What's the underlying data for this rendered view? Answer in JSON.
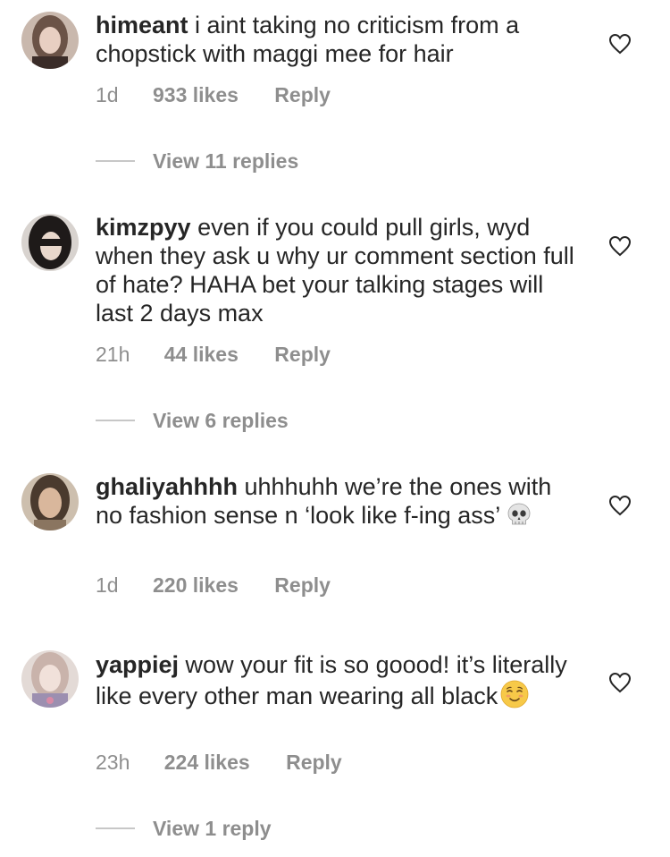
{
  "comments": [
    {
      "username": "himeant",
      "text": " i aint taking no criticism from a chopstick with maggi mee for hair",
      "time": "1d",
      "likes": "933 likes",
      "reply": "Reply",
      "view_replies": "View 11 replies"
    },
    {
      "username": "kimzpyy",
      "text": " even if you could pull girls, wyd when they ask u why ur comment section full of hate? HAHA bet your talking stages will last 2 days max",
      "time": "21h",
      "likes": "44 likes",
      "reply": "Reply",
      "view_replies": "View 6 replies"
    },
    {
      "username": "ghaliyahhhh",
      "text": " uhhhuhh we’re the ones with no fashion sense n ‘look like f-ing ass’",
      "emoji": "skull-emoji",
      "time": "1d",
      "likes": "220 likes",
      "reply": "Reply"
    },
    {
      "username": "yappiej",
      "text": " wow your fit is so goood! it’s literally like every other man wearing all black",
      "emoji": "relieved-face-emoji",
      "time": "23h",
      "likes": "224 likes",
      "reply": "Reply",
      "view_replies": "View 1 reply"
    }
  ],
  "colors": {
    "text": "#262626",
    "secondary": "#8e8e8e",
    "line": "#c7c7c7",
    "background": "#ffffff"
  },
  "icons": {
    "like": "heart-outline-icon"
  }
}
